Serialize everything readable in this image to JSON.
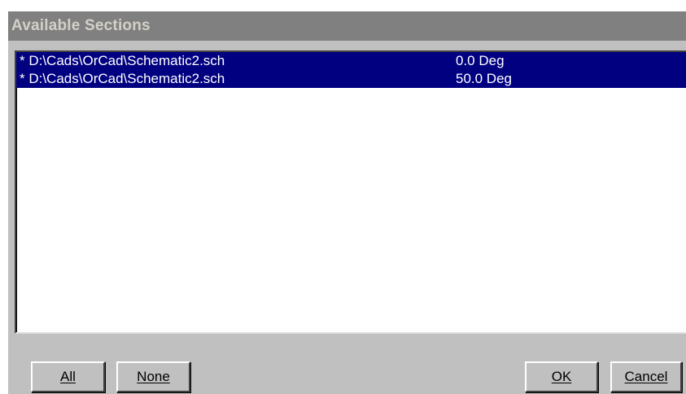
{
  "dialog": {
    "title": "Available Sections"
  },
  "sections": [
    {
      "path": "* D:\\Cads\\OrCad\\Schematic2.sch",
      "angle": "0.0 Deg"
    },
    {
      "path": "* D:\\Cads\\OrCad\\Schematic2.sch",
      "angle": "50.0 Deg"
    }
  ],
  "buttons": {
    "all": "All",
    "none": "None",
    "ok": "OK",
    "cancel": "Cancel"
  },
  "colors": {
    "selection": "#000080",
    "title_bar": "#808080",
    "face": "#c0c0c0"
  }
}
